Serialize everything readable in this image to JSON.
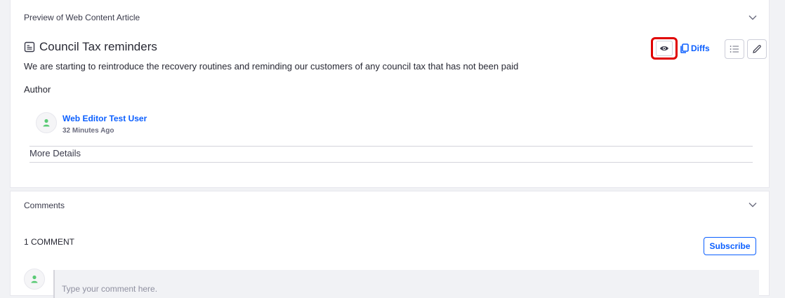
{
  "preview": {
    "header": "Preview of Web Content Article",
    "title": "Council Tax reminders",
    "description": "We are starting to reintroduce the recovery routines and reminding our customers of any council tax that has not been paid",
    "author_label": "Author",
    "author": {
      "name": "Web Editor Test User",
      "time": "32 Minutes Ago"
    },
    "more_details": "More Details",
    "actions": {
      "diffs_label": "Diffs"
    }
  },
  "comments": {
    "header": "Comments",
    "count_label": "1 COMMENT",
    "subscribe_label": "Subscribe",
    "input_placeholder": "Type your comment here."
  },
  "colors": {
    "accent": "#0b5fff",
    "highlight": "#e00000",
    "avatar_green": "#5aca75"
  },
  "icons": [
    "chevron-down-icon",
    "article-icon",
    "user-icon",
    "eye-icon",
    "copy-icon",
    "list-icon",
    "pencil-icon"
  ]
}
